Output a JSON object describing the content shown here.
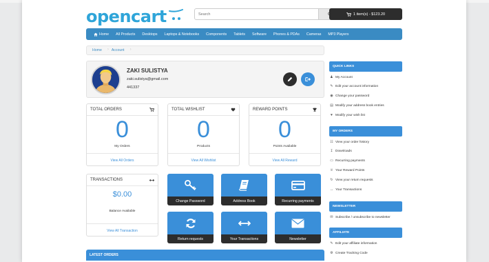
{
  "header": {
    "logo_text": "opencart",
    "search_placeholder": "Search",
    "cart_label": "1 item(s) - $123.20"
  },
  "nav": {
    "items": [
      {
        "label": "Home",
        "icon": "home-icon"
      },
      {
        "label": "All Products"
      },
      {
        "label": "Desktops"
      },
      {
        "label": "Laptops & Notebooks"
      },
      {
        "label": "Components"
      },
      {
        "label": "Tablets"
      },
      {
        "label": "Software"
      },
      {
        "label": "Phones & PDAs"
      },
      {
        "label": "Cameras"
      },
      {
        "label": "MP3 Players"
      }
    ]
  },
  "breadcrumb": [
    "Home",
    "Account"
  ],
  "profile": {
    "name": "ZAKI SULISTYA",
    "email": "zaki.sulistya@gmail.com",
    "phone": "441337"
  },
  "stats": {
    "orders": {
      "title": "TOTAL ORDERS",
      "value": "0",
      "sub": "My Orders",
      "link": "View All Orders",
      "icon": "cart-icon"
    },
    "wishlist": {
      "title": "TOTAL WISHLIST",
      "value": "0",
      "sub": "Products",
      "link": "View All Wishlist",
      "icon": "heart-icon"
    },
    "reward": {
      "title": "REWARD POINTS",
      "value": "0",
      "sub": "Points Available",
      "link": "View All Reward",
      "icon": "trophy-icon"
    }
  },
  "transactions": {
    "title": "TRANSACTIONS",
    "amount": "$0.00",
    "sub": "Balance Available",
    "link": "View All Transaction",
    "icon": "arrows-horizontal-icon"
  },
  "tiles": [
    {
      "label": "Change Password",
      "icon": "key-icon"
    },
    {
      "label": "Address Book",
      "icon": "book-icon"
    },
    {
      "label": "Recurring payments",
      "icon": "credit-card-icon"
    },
    {
      "label": "Return requests",
      "icon": "refresh-icon"
    },
    {
      "label": "Your Transactions",
      "icon": "arrows-horizontal-icon"
    },
    {
      "label": "Newsletter",
      "icon": "envelope-icon"
    }
  ],
  "latest_orders": "LATEST ORDERS",
  "sidebar": {
    "quick_links": {
      "title": "QUICK LINKS",
      "items": [
        {
          "label": "My Account",
          "icon": "user-icon"
        },
        {
          "label": "Edit your account information",
          "icon": "pencil-icon"
        },
        {
          "label": "Change your password",
          "icon": "eye-icon"
        },
        {
          "label": "Modify your address book entries",
          "icon": "book-icon"
        },
        {
          "label": "Modify your wish list",
          "icon": "heart-icon"
        }
      ]
    },
    "my_orders": {
      "title": "MY ORDERS",
      "items": [
        {
          "label": "View your order history",
          "icon": "cart-icon"
        },
        {
          "label": "Downloads",
          "icon": "download-icon"
        },
        {
          "label": "Recurring payments",
          "icon": "credit-card-icon"
        },
        {
          "label": "Your Reward Points",
          "icon": "trophy-icon"
        },
        {
          "label": "View your return requests",
          "icon": "refresh-icon"
        },
        {
          "label": "Your Transactions",
          "icon": "arrows-horizontal-icon"
        }
      ]
    },
    "newsletter": {
      "title": "NEWSLETTER",
      "items": [
        {
          "label": "Subscribe / unsubscribe to newsletter",
          "icon": "envelope-icon"
        }
      ]
    },
    "affiliate": {
      "title": "AFFILIATE",
      "items": [
        {
          "label": "Edit your affiliate information",
          "icon": "pencil-icon"
        },
        {
          "label": "Create Tracking Code",
          "icon": "gear-icon"
        }
      ]
    }
  },
  "colors": {
    "accent": "#3a8fd9",
    "nav": "#3a8bc3",
    "dark": "#2d2d2d",
    "logo": "#2fa5d9"
  }
}
